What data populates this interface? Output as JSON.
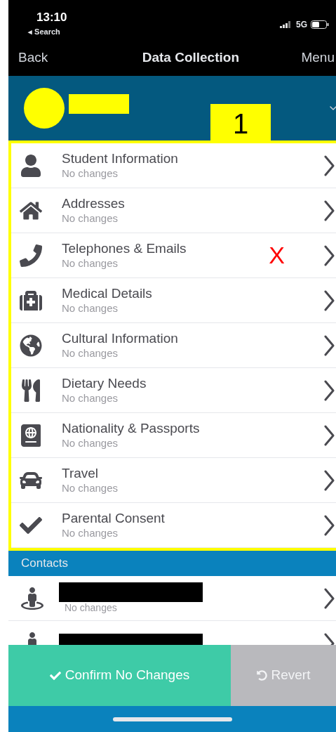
{
  "status_bar": {
    "time": "13:10",
    "back_app": "◂ Search",
    "network": "5G"
  },
  "nav": {
    "back": "Back",
    "title": "Data Collection",
    "menu": "Menu"
  },
  "callout": {
    "label": "1"
  },
  "sections": [
    {
      "title": "Student Information",
      "subtitle": "No changes"
    },
    {
      "title": "Addresses",
      "subtitle": "No changes"
    },
    {
      "title": "Telephones & Emails",
      "subtitle": "No changes",
      "mark": "X"
    },
    {
      "title": "Medical Details",
      "subtitle": "No changes"
    },
    {
      "title": "Cultural Information",
      "subtitle": "No changes"
    },
    {
      "title": "Dietary Needs",
      "subtitle": "No changes"
    },
    {
      "title": "Nationality & Passports",
      "subtitle": "No changes"
    },
    {
      "title": "Travel",
      "subtitle": "No changes"
    },
    {
      "title": "Parental Consent",
      "subtitle": "No changes"
    }
  ],
  "contacts": {
    "heading": "Contacts",
    "rows": [
      {
        "subtitle": "No changes"
      },
      {}
    ]
  },
  "buttons": {
    "confirm": "Confirm No Changes",
    "revert": "Revert"
  }
}
